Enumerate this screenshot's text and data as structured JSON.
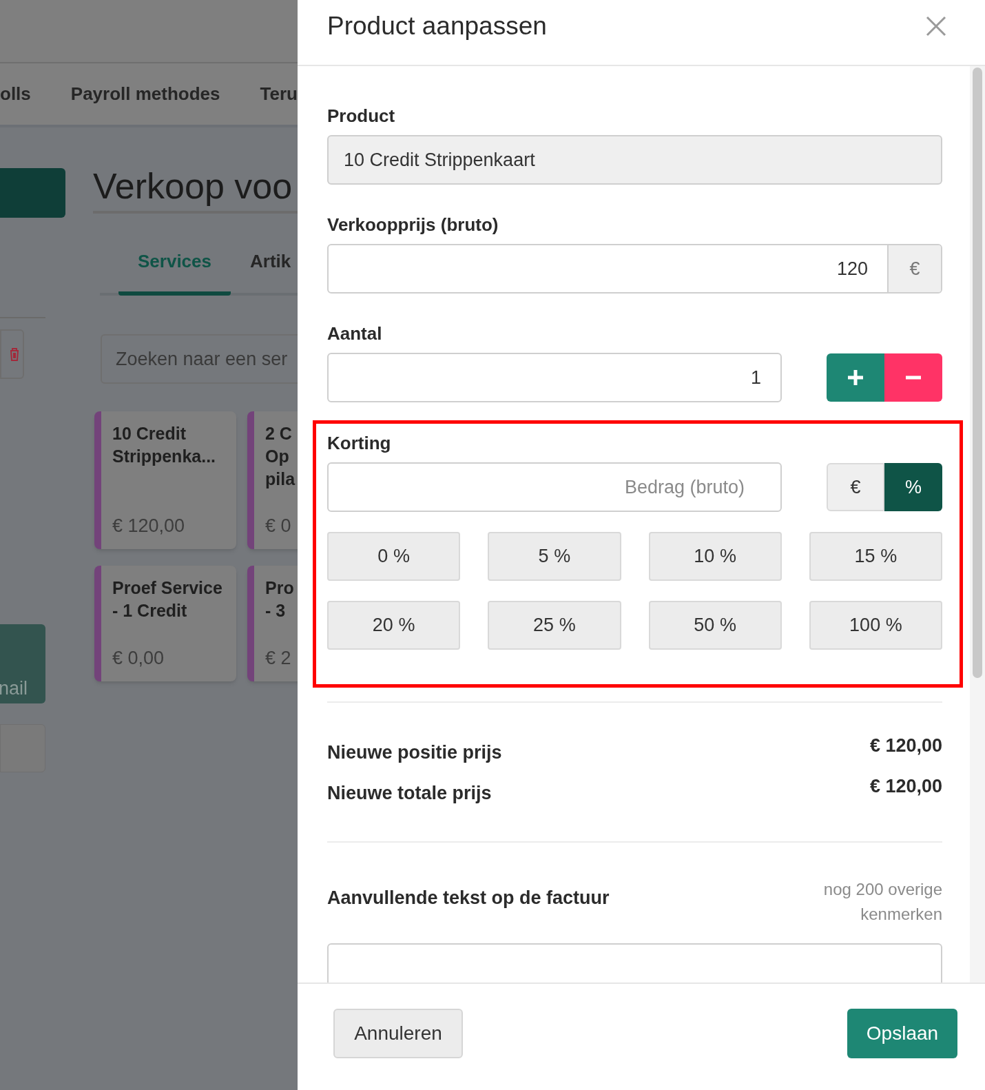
{
  "background": {
    "nav_tabs": [
      "olls",
      "Payroll methodes",
      "Teru"
    ],
    "page_title": "Verkoop voo",
    "category_tabs": [
      {
        "label": "Services",
        "selected": true
      },
      {
        "label": "Artik",
        "selected": false
      }
    ],
    "search": {
      "placeholder": "Zoeken naar een ser"
    },
    "side_tile": "nail",
    "cards": [
      {
        "lines": [
          "10 Credit",
          "Strippenka..."
        ],
        "price": "€ 120,00"
      },
      {
        "lines": [
          "2 C",
          "Op",
          "pila"
        ],
        "price": "€ 0"
      },
      {
        "lines": [
          "Proef Service",
          "- 1 Credit"
        ],
        "price": "€ 0,00"
      },
      {
        "lines": [
          "Pro",
          "- 3"
        ],
        "price": "€ 2"
      }
    ]
  },
  "drawer": {
    "title": "Product aanpassen",
    "product": {
      "label": "Product",
      "value": "10 Credit Strippenkaart"
    },
    "price": {
      "label": "Verkoopprijs (bruto)",
      "value": "120",
      "unit": "€"
    },
    "quantity": {
      "label": "Aantal",
      "value": "1"
    },
    "discount": {
      "label": "Korting",
      "placeholder": "Bedrag (bruto)",
      "units": [
        {
          "label": "€",
          "selected": false
        },
        {
          "label": "%",
          "selected": true
        }
      ],
      "presets": [
        "0 %",
        "5 %",
        "10 %",
        "15 %",
        "20 %",
        "25 %",
        "50 %",
        "100 %"
      ]
    },
    "summary": [
      {
        "label": "Nieuwe positie prijs",
        "value": "€ 120,00"
      },
      {
        "label": "Nieuwe totale prijs",
        "value": "€ 120,00"
      }
    ],
    "note": {
      "label": "Aanvullende tekst op de factuur",
      "counter": "nog 200 overige kenmerken"
    },
    "buttons": {
      "cancel": "Annuleren",
      "save": "Opslaan"
    }
  }
}
